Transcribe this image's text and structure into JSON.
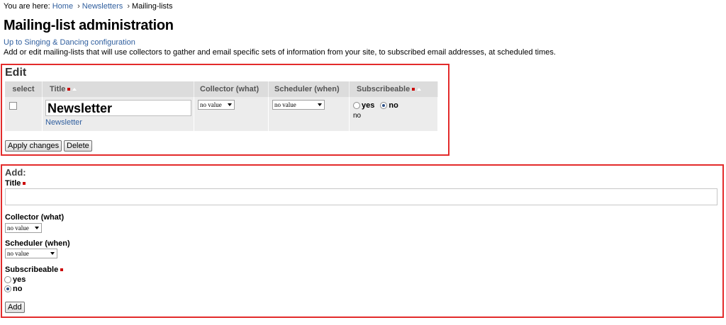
{
  "breadcrumb": {
    "prefix": "You are here:",
    "items": [
      {
        "label": "Home"
      },
      {
        "label": "Newsletters"
      },
      {
        "label": "Mailing-lists"
      }
    ],
    "separator": "›"
  },
  "page": {
    "title": "Mailing-list administration",
    "up_link": "Up to Singing & Dancing configuration",
    "description": "Add or edit mailing-lists that will use collectors to gather and email specific sets of information from your site, to subscribed email addresses, at scheduled times."
  },
  "edit": {
    "heading": "Edit",
    "columns": {
      "select": "select",
      "title": "Title",
      "collector": "Collector (what)",
      "scheduler": "Scheduler (when)",
      "subscribeable": "Subscribeable"
    },
    "rows": [
      {
        "checked": false,
        "title_value": "Newsletter",
        "title_link": "Newsletter",
        "collector": "no value",
        "scheduler": "no value",
        "yes_label": "yes",
        "no_label": "no",
        "selected": "no",
        "current": "no"
      }
    ],
    "apply_label": "Apply changes",
    "delete_label": "Delete"
  },
  "add": {
    "heading": "Add:",
    "title_label": "Title",
    "title_value": "",
    "collector_label": "Collector (what)",
    "collector_value": "no value",
    "scheduler_label": "Scheduler (when)",
    "scheduler_value": "no value",
    "subscribeable_label": "Subscribeable",
    "yes_label": "yes",
    "no_label": "no",
    "selected": "no",
    "add_label": "Add"
  },
  "colors": {
    "accent_border": "#e32b2b",
    "required_marker": "#cc0000",
    "link": "#2f5e9e",
    "header_bg": "#dcdcdc",
    "row_bg": "#ececec"
  },
  "icons": [
    "required-marker-icon",
    "sort-arrow-icon",
    "dropdown-arrow-icon"
  ]
}
